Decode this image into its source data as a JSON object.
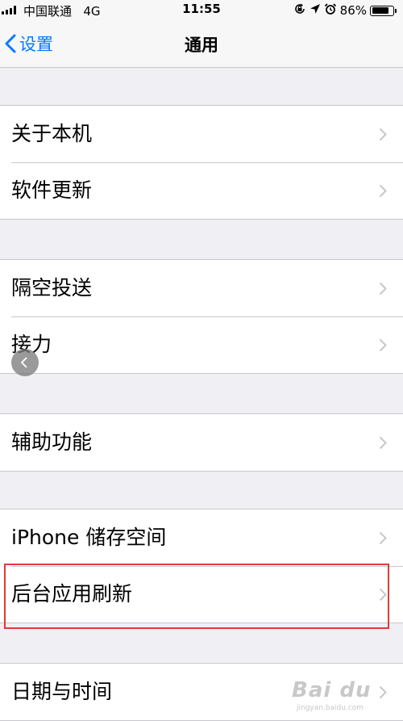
{
  "status_bar": {
    "carrier": "中国联通",
    "network": "4G",
    "time": "11:55",
    "battery": "86%",
    "battery_level": 0.86
  },
  "nav": {
    "back_label": "设置",
    "title": "通用"
  },
  "groups": [
    {
      "items": [
        {
          "label": "关于本机"
        },
        {
          "label": "软件更新"
        }
      ]
    },
    {
      "items": [
        {
          "label": "隔空投送"
        },
        {
          "label": "接力"
        }
      ]
    },
    {
      "items": [
        {
          "label": "辅助功能"
        }
      ]
    },
    {
      "items": [
        {
          "label": "iPhone 储存空间"
        },
        {
          "label": "后台应用刷新",
          "highlighted": true
        }
      ]
    },
    {
      "items": [
        {
          "label": "日期与时间"
        }
      ]
    }
  ],
  "watermark": {
    "text": "Bai du",
    "subtext": "jingyan.baidu.com"
  },
  "colors": {
    "accent": "#007aff",
    "highlight": "#e23a3a",
    "background": "#efeff4"
  },
  "icons": [
    "signal-icon",
    "rotation-lock-icon",
    "location-icon",
    "alarm-icon",
    "battery-icon",
    "back-chevron-icon",
    "chevron-right-icon"
  ]
}
